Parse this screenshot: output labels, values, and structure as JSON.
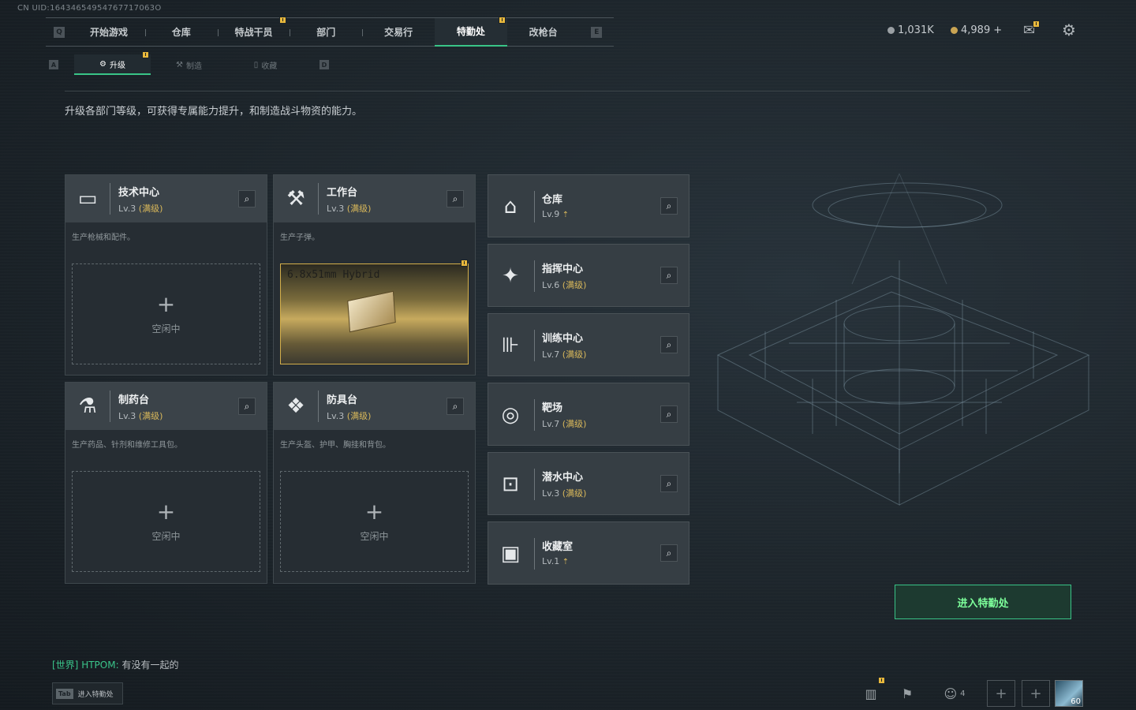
{
  "uid": "CN UID:16434654954767717063O",
  "nav": {
    "left_key": "Q",
    "right_key": "E",
    "tabs": [
      {
        "label": "开始游戏"
      },
      {
        "label": "仓库"
      },
      {
        "label": "特战干员"
      },
      {
        "label": "部门"
      },
      {
        "label": "交易行"
      },
      {
        "label": "特勤处"
      },
      {
        "label": "改枪台"
      }
    ]
  },
  "subnav": {
    "left_key": "A",
    "right_key": "D",
    "tabs": [
      {
        "label": "升级"
      },
      {
        "label": "制造"
      },
      {
        "label": "收藏"
      }
    ]
  },
  "currency": {
    "silver": "1,031K",
    "gold": "4,989"
  },
  "description": "升级各部门等级，可获得专属能力提升，和制造战斗物资的能力。",
  "workshops": [
    {
      "name": "技术中心",
      "level": "Lv.3",
      "max": "(满级)",
      "sub": "生产枪械和配件。",
      "slot": "空闲中"
    },
    {
      "name": "工作台",
      "level": "Lv.3",
      "max": "(满级)",
      "sub": "生产子弹。",
      "item": "6.8x51mm Hybrid"
    },
    {
      "name": "制药台",
      "level": "Lv.3",
      "max": "(满级)",
      "sub": "生产药品、针剂和维修工具包。",
      "slot": "空闲中"
    },
    {
      "name": "防具台",
      "level": "Lv.3",
      "max": "(满级)",
      "sub": "生产头盔、护甲、胸挂和背包。",
      "slot": "空闲中"
    }
  ],
  "facilities": [
    {
      "name": "仓库",
      "level": "Lv.9",
      "max": ""
    },
    {
      "name": "指挥中心",
      "level": "Lv.6",
      "max": "(满级)"
    },
    {
      "name": "训练中心",
      "level": "Lv.7",
      "max": "(满级)"
    },
    {
      "name": "靶场",
      "level": "Lv.7",
      "max": "(满级)"
    },
    {
      "name": "潜水中心",
      "level": "Lv.3",
      "max": "(满级)"
    },
    {
      "name": "收藏室",
      "level": "Lv.1",
      "max": ""
    }
  ],
  "enter_button": "进入特勤处",
  "chat": {
    "channel": "[世界]",
    "user": "HTPOM:",
    "message": "有没有一起的"
  },
  "tab_hint": {
    "key": "Tab",
    "label": "进入特勤处"
  },
  "friends_count": "4",
  "player_level": "60",
  "colors": {
    "accent": "#39c487",
    "gold": "#d9b85a",
    "notify": "#e8b83c"
  }
}
